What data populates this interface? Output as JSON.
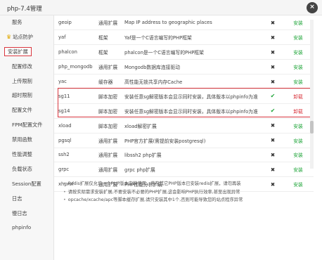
{
  "window": {
    "title": "php-7.4管理",
    "close_label": "×"
  },
  "sidebar": {
    "items": [
      {
        "label": "服务"
      },
      {
        "label": "站点防护"
      },
      {
        "label": "安装扩展"
      },
      {
        "label": "配置修改"
      },
      {
        "label": "上传限制"
      },
      {
        "label": "超时限制"
      },
      {
        "label": "配置文件"
      },
      {
        "label": "FPM配置文件"
      },
      {
        "label": "禁用函数"
      },
      {
        "label": "性能调整"
      },
      {
        "label": "负载状态"
      },
      {
        "label": "Session配置"
      },
      {
        "label": "日志"
      },
      {
        "label": "慢日志"
      },
      {
        "label": "phpinfo"
      }
    ]
  },
  "extensions": [
    {
      "name": "geoip",
      "type": "通用扩展",
      "desc": "Map IP address to geographic places",
      "status": "✖",
      "action": "安装"
    },
    {
      "name": "yaf",
      "type": "框架",
      "desc": "Yaf是一个C语言编写的PHP框架",
      "status": "✖",
      "action": "安装"
    },
    {
      "name": "phalcon",
      "type": "框架",
      "desc": "phalcon是一个C语言编写的PHP框架",
      "status": "✖",
      "action": "安装"
    },
    {
      "name": "php_mongodb",
      "type": "通用扩展",
      "desc": "Mongodb数据库连接驱动",
      "status": "✖",
      "action": "安装"
    },
    {
      "name": "yac",
      "type": "缓存器",
      "desc": "高性能无锁共享内存Cache",
      "status": "✖",
      "action": "安装"
    },
    {
      "name": "sg11",
      "type": "脚本加密",
      "desc": "安装任意sg解密版本会显示同时安装，具体版本以phpinfo为准",
      "status": "✔",
      "action": "卸载"
    },
    {
      "name": "sg14",
      "type": "脚本加密",
      "desc": "安装任意sg解密版本会显示同时安装，具体版本以phpinfo为准",
      "status": "✔",
      "action": "卸载"
    },
    {
      "name": "xload",
      "type": "脚本加密",
      "desc": "xload解密扩展",
      "status": "✖",
      "action": "安装"
    },
    {
      "name": "pgsql",
      "type": "通用扩展",
      "desc": "PHP官方扩展(需提前安装postgresql)",
      "status": "✖",
      "action": "安装"
    },
    {
      "name": "ssh2",
      "type": "通用扩展",
      "desc": "libssh2 php扩展",
      "status": "✖",
      "action": "安装"
    },
    {
      "name": "grpc",
      "type": "通用扩展",
      "desc": "grpc php扩展",
      "status": "✖",
      "action": "安装"
    },
    {
      "name": "xhprof",
      "type": "通用扩展",
      "desc": "PHP性能分析扩展",
      "status": "✖",
      "action": "安装"
    }
  ],
  "notes": [
    "Redis扩展仅允许一个PHP版本安装使用，若在其它PHP版本已安装redis扩展，请勿再装",
    "请按实际需求安装扩展,不要安装不必要的PHP扩展,这会影响PHP执行效率,甚至出现异常",
    "opcache/xcache/apc等脚本缓存扩展,请只安装其中1个,否则可能导致您的站点程序异常"
  ],
  "colors": {
    "accent": "#20a53a",
    "danger": "#d9363e"
  }
}
